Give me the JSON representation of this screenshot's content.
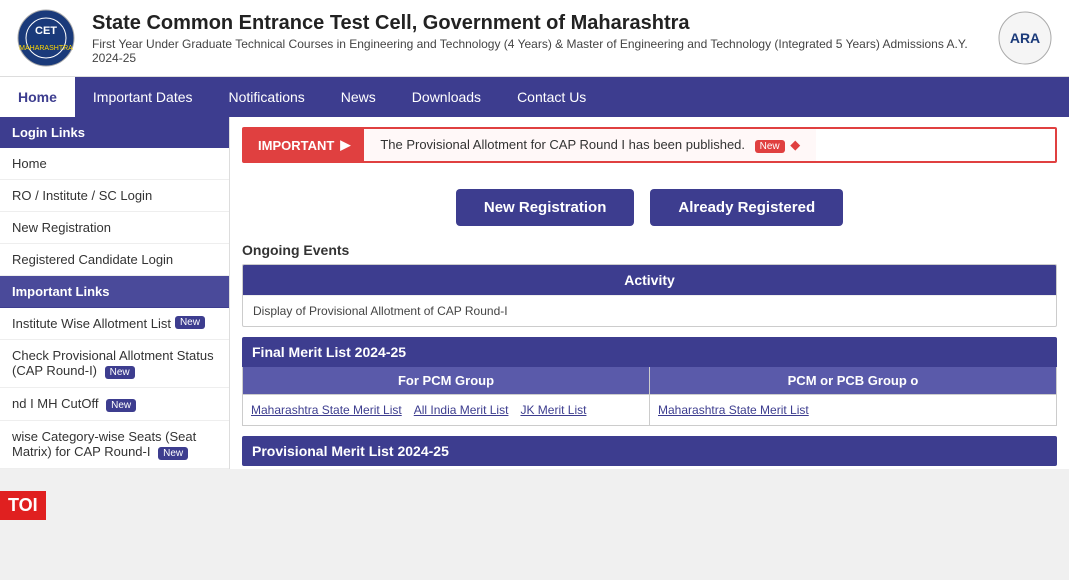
{
  "header": {
    "title": "State Common Entrance Test Cell, Government of Maharashtra",
    "subtitle": "First Year Under Graduate Technical Courses in Engineering and Technology (4 Years) & Master of Engineering and Technology (Integrated 5 Years) Admissions A.Y. 2024-25"
  },
  "navbar": {
    "items": [
      {
        "label": "Home",
        "active": true
      },
      {
        "label": "Important Dates",
        "active": false
      },
      {
        "label": "Notifications",
        "active": false
      },
      {
        "label": "News",
        "active": false
      },
      {
        "label": "Downloads",
        "active": false
      },
      {
        "label": "Contact Us",
        "active": false
      }
    ]
  },
  "sidebar": {
    "group1_label": "Login Links",
    "items1": [
      {
        "label": "Home",
        "active": false
      },
      {
        "label": "RO / Institute / SC Login",
        "active": false
      },
      {
        "label": "New Registration",
        "active": false
      },
      {
        "label": "Registered Candidate Login",
        "active": false
      }
    ],
    "group2_label": "Important Links",
    "items2": [
      {
        "label": "Institute Wise Allotment List",
        "badge": "New",
        "active": false
      },
      {
        "label": "Check Provisional Allotment Status (CAP Round-I)",
        "badge": "New",
        "active": false
      },
      {
        "label": "nd I MH CutOff",
        "badge": "New",
        "active": false
      },
      {
        "label": "wise Category-wise Seats (Seat Matrix) for CAP Round-I",
        "badge": "New",
        "active": false
      }
    ]
  },
  "important": {
    "label": "IMPORTANT",
    "text": "The Provisional Allotment for CAP Round I has been published.",
    "badge": "New"
  },
  "buttons": {
    "new_registration": "New Registration",
    "already_registered": "Already Registered"
  },
  "ongoing_events": {
    "title": "Ongoing Events",
    "activity_header": "Activity",
    "activity_row": "Display of Provisional Allotment of CAP Round-I"
  },
  "final_merit": {
    "title": "Final Merit List 2024-25",
    "col1_header": "For PCM Group",
    "col1_links": [
      "Maharashtra State Merit List",
      "All India Merit List",
      "JK Merit List"
    ],
    "col2_header": "PCM or PCB Group o",
    "col2_links": [
      "Maharashtra State Merit List"
    ]
  },
  "provisional_merit": {
    "title": "Provisional Merit List 2024-25"
  },
  "toi": {
    "label": "TOI"
  }
}
